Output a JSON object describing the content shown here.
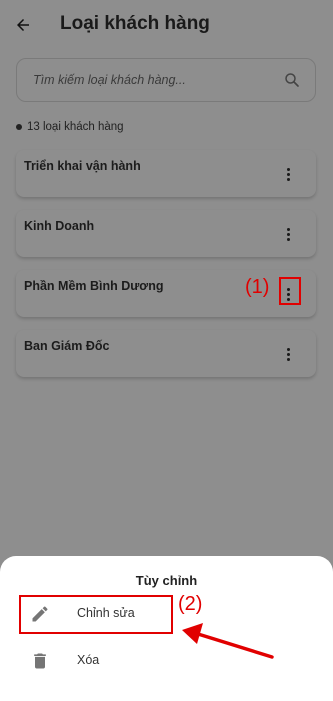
{
  "header": {
    "title": "Loại khách hàng"
  },
  "search": {
    "placeholder": "Tìm kiếm loại khách hàng..."
  },
  "list": {
    "count_text": "13 loại khách hàng",
    "items": [
      {
        "label": "Triển khai vận hành"
      },
      {
        "label": "Kinh Doanh"
      },
      {
        "label": "Phần Mềm Bình Dương"
      },
      {
        "label": "Ban Giám Đốc"
      }
    ]
  },
  "annotations": {
    "step1": "(1)",
    "step2": "(2)"
  },
  "sheet": {
    "title": "Tùy chỉnh",
    "items": [
      {
        "label": "Chỉnh sửa",
        "icon": "pencil-icon"
      },
      {
        "label": "Xóa",
        "icon": "trash-icon"
      }
    ]
  },
  "colors": {
    "overlay_bg": "#8e8e8e",
    "annotation": "#e10000",
    "sheet_bg": "#ffffff"
  }
}
